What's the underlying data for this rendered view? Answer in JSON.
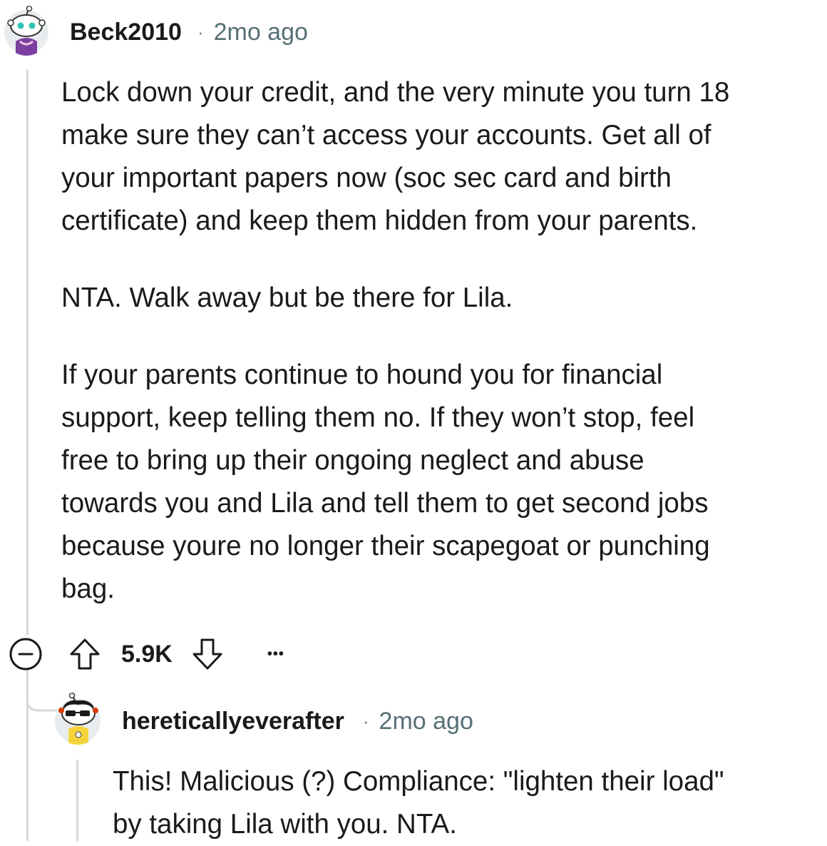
{
  "comments": [
    {
      "username": "Beck2010",
      "separator": "·",
      "timestamp": "2mo ago",
      "paragraphs": [
        [
          "Lock down your credit, and the very minute you turn 18",
          "make sure they can’t access your accounts. Get all of",
          "your important papers now (soc sec card and birth",
          "certificate) and keep them hidden from your parents."
        ],
        [
          "NTA. Walk away but be there for Lila."
        ],
        [
          "If your parents continue to hound you for financial",
          "support, keep telling them no. If they won’t stop, feel",
          "free to bring up their ongoing neglect and abuse",
          "towards you and Lila and tell them to get second jobs",
          "because youre no longer their scapegoat or punching",
          "bag."
        ]
      ],
      "score": "5.9K",
      "icons": {
        "collapse": "collapse-minus-icon",
        "upvote": "upvote-arrow-icon",
        "downvote": "downvote-arrow-icon",
        "more": "more-options-icon"
      },
      "more_label": "•••"
    },
    {
      "username": "hereticallyeverafter",
      "separator": "·",
      "timestamp": "2mo ago",
      "lines": [
        "This! Malicious (?) Compliance: \"lighten their load\"",
        "by taking Lila with you. NTA."
      ]
    }
  ],
  "colors": {
    "text": "#1a1a1b",
    "meta": "#576f76",
    "thread_line": "#d7dadc",
    "icon_stroke": "#1a1a1b"
  }
}
